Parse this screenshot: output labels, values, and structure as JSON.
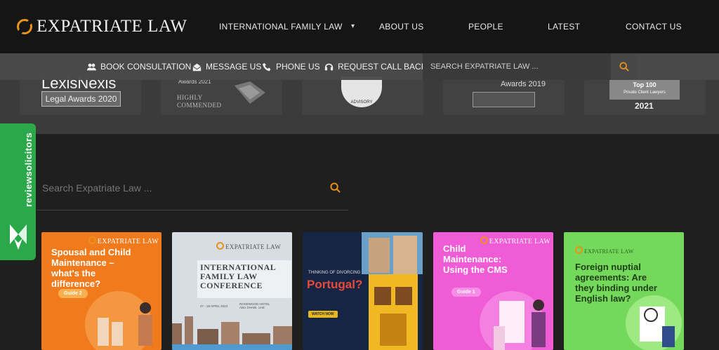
{
  "header": {
    "logo_text": "EXPATRIATE LAW",
    "nav": [
      "INTERNATIONAL FAMILY LAW",
      "ABOUT US",
      "PEOPLE",
      "LATEST",
      "CONTACT US"
    ]
  },
  "subbar": {
    "items": [
      "BOOK CONSULTATION",
      "MESSAGE US",
      "PHONE US",
      "REQUEST CALL BACK"
    ],
    "search_placeholder": "SEARCH EXPATRIATE LAW ..."
  },
  "awards": {
    "lexis_title": "LexisNexis",
    "lexis_sub": "Legal Awards 2020",
    "a2_title": "Awards 2021",
    "a2_highly": "HIGHLY COMMENDED",
    "tatler": "ADVISORY",
    "a4_title": "Awards 2019",
    "a5_line1": "Top 100",
    "a5_line2": "Private Client Lawyers",
    "a5_year": "2021"
  },
  "review_tab": {
    "label": "reviewsolicitors"
  },
  "search": {
    "placeholder": "Search Expatriate Law ..."
  },
  "cards": [
    {
      "brand": "EXPATRIATE LAW",
      "title": "Spousal and Child Maintenance – what's the difference?",
      "tag": "Guide 2"
    },
    {
      "brand": "EXPATRIATE LAW",
      "title": "INTERNATIONAL FAMILY LAW CONFERENCE",
      "date": "27 - 28 APRIL 2023",
      "venue": "ROSEWOOD HOTEL ABU DHABI, UAE"
    },
    {
      "brand": "",
      "kicker": "THINKING OF DIVORCING IN",
      "title": "Portugal?",
      "tag": "WATCH NOW"
    },
    {
      "brand": "EXPATRIATE LAW",
      "title": "Child Maintenance: Using the CMS",
      "tag": "Guide 1"
    },
    {
      "brand": "EXPATRIATE LAW",
      "title": "Foreign nuptial agreements: Are they binding under English law?"
    }
  ],
  "colors": {
    "accent": "#e8931a",
    "review_green": "#2aa84a"
  }
}
